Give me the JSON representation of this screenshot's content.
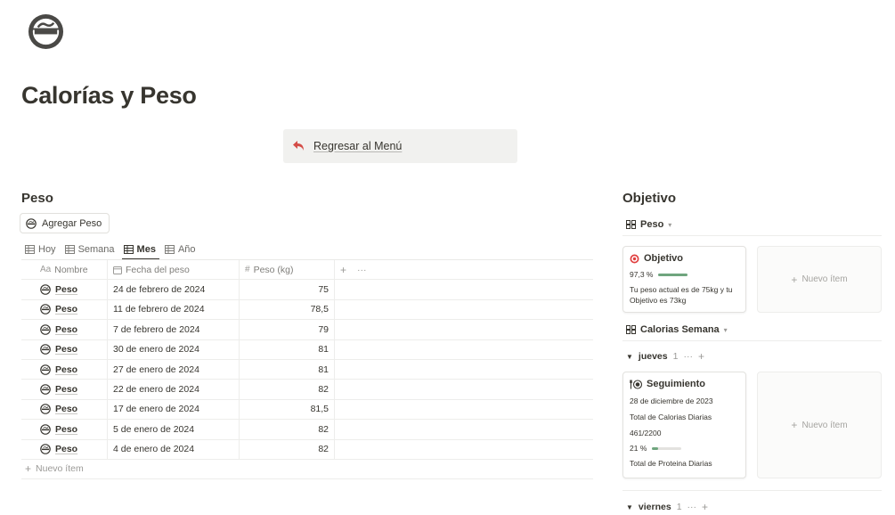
{
  "page": {
    "icon": "no-smoking-icon",
    "title": "Calorías y Peso"
  },
  "callout": {
    "icon": "return-arrow-icon",
    "link": "Regresar al Menú"
  },
  "peso": {
    "heading": "Peso",
    "add_button": "Agregar Peso",
    "views": [
      {
        "label": "Hoy",
        "icon": "table-icon"
      },
      {
        "label": "Semana",
        "icon": "table-icon"
      },
      {
        "label": "Mes",
        "icon": "table-icon",
        "active": true
      },
      {
        "label": "Año",
        "icon": "table-icon"
      }
    ],
    "columns": {
      "name": "Nombre",
      "name_icon": "Aa",
      "date": "Fecha del peso",
      "weight": "Peso (kg)",
      "weight_icon": "#",
      "add": "+",
      "more": "···"
    },
    "rows": [
      {
        "name": "Peso",
        "date": "24 de febrero de 2024",
        "weight": "75"
      },
      {
        "name": "Peso",
        "date": "11 de febrero de 2024",
        "weight": "78,5"
      },
      {
        "name": "Peso",
        "date": "7 de febrero de 2024",
        "weight": "79"
      },
      {
        "name": "Peso",
        "date": "30 de enero de 2024",
        "weight": "81"
      },
      {
        "name": "Peso",
        "date": "27 de enero de 2024",
        "weight": "81"
      },
      {
        "name": "Peso",
        "date": "22 de enero de 2024",
        "weight": "82"
      },
      {
        "name": "Peso",
        "date": "17 de enero de 2024",
        "weight": "81,5"
      },
      {
        "name": "Peso",
        "date": "5 de enero de 2024",
        "weight": "82"
      },
      {
        "name": "Peso",
        "date": "4 de enero de 2024",
        "weight": "82"
      }
    ],
    "new_item": "Nuevo ítem"
  },
  "objetivo": {
    "heading": "Objetivo",
    "group1": {
      "label": "Peso",
      "card": {
        "title": "Objetivo",
        "percent_text": "97,3 %",
        "progress": 0.973,
        "desc_line1": "Tu peso actual es de 75kg y tu",
        "desc_line2": "Objetivo es 73kg"
      },
      "new_item": "Nuevo ítem"
    },
    "group2": {
      "label": "Calorias Semana",
      "sub1": {
        "label": "jueves",
        "count": "1",
        "more": "···",
        "add": "+",
        "card": {
          "title": "Seguimiento",
          "date": "28 de diciembre de 2023",
          "line1": "Total de Calorias Diarias",
          "line2": "461/2200",
          "percent_text": "21 %",
          "progress": 0.21,
          "line3": "Total de Proteina Diarias"
        },
        "new_item": "Nuevo ítem"
      },
      "sub2": {
        "label": "viernes",
        "count": "1",
        "more": "···",
        "add": "+"
      }
    }
  },
  "colors": {
    "text": "#37352f",
    "muted": "#9b9a97",
    "callout_bg": "#f1f1ef",
    "progress": "#6fa57e",
    "arrow": "#d44c47",
    "target": "#e03e3e"
  }
}
